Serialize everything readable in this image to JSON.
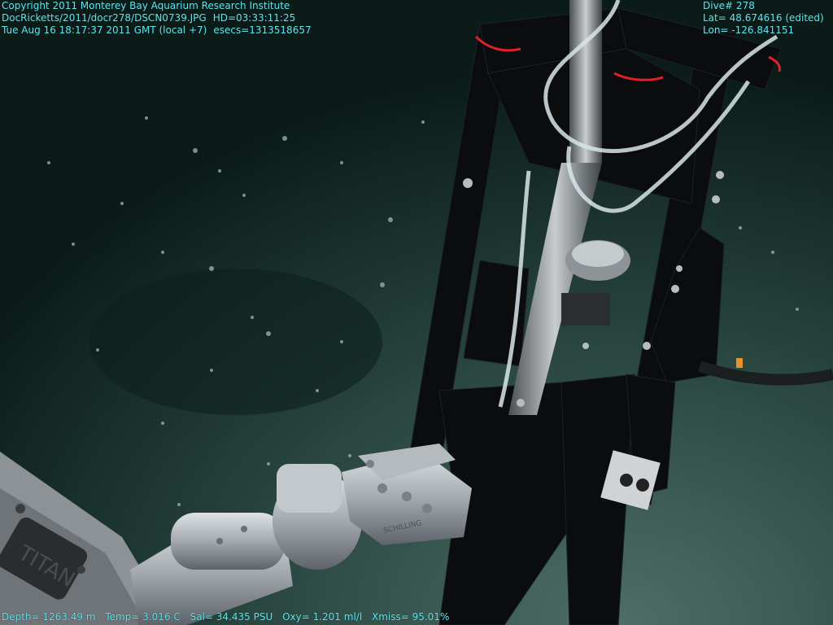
{
  "overlay": {
    "top_left": {
      "line1": "Copyright 2011 Monterey Bay Aquarium Research Institute",
      "line2_file": "DocRicketts/2011/docr278/DSCN0739.JPG",
      "line2_hd": "HD=03:33:11:25",
      "line3_time": "Tue Aug 16 18:17:37 2011 GMT (local +7)",
      "line3_esecs": "esecs=1313518657"
    },
    "top_right": {
      "dive": "Dive# 278",
      "lat": "Lat= 48.674616 (edited)",
      "lon": "Lon= -126.841151"
    },
    "bottom": {
      "depth": "Depth= 1263.49 m",
      "temp": "Temp= 3.016 C",
      "sal": "Sal= 34.435 PSU",
      "oxy": "Oxy= 1.201 ml/l",
      "xmiss": "Xmiss= 95.01%"
    }
  },
  "scene": {
    "arm_wrist_label": "SCHILLING",
    "arm_panel_label": "TITAN",
    "colors": {
      "seafloor_light": "#2f5048",
      "seafloor_dark": "#0b1d1a",
      "frame": "#0a0c0d",
      "arm_metal": "#a9aeb3",
      "hud_text": "#5fe6ee",
      "tie_red": "#e0202a",
      "tube": "#d8e6ea"
    }
  }
}
